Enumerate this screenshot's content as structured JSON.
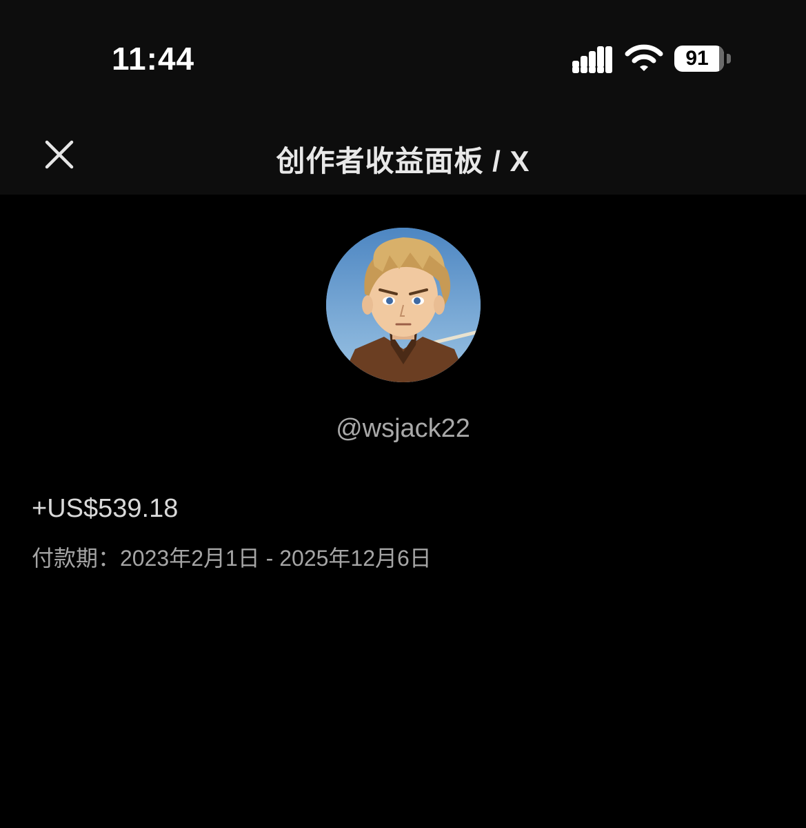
{
  "status_bar": {
    "time": "11:44",
    "battery_level": "91",
    "icons": [
      "signal-icon",
      "wifi-icon",
      "battery-icon"
    ]
  },
  "nav": {
    "title": "创作者收益面板 / X",
    "close_icon": "close-icon"
  },
  "profile": {
    "avatar": "avatar",
    "username": "@wsjack22"
  },
  "earnings": {
    "amount": "+US$539.18",
    "period": "付款期：2023年2月1日 - 2025年12月6日"
  },
  "colors": {
    "background": "#000000",
    "header_background": "#0d0d0d",
    "title_text": "#e8e8e8",
    "secondary_text": "#a5a5a5"
  }
}
